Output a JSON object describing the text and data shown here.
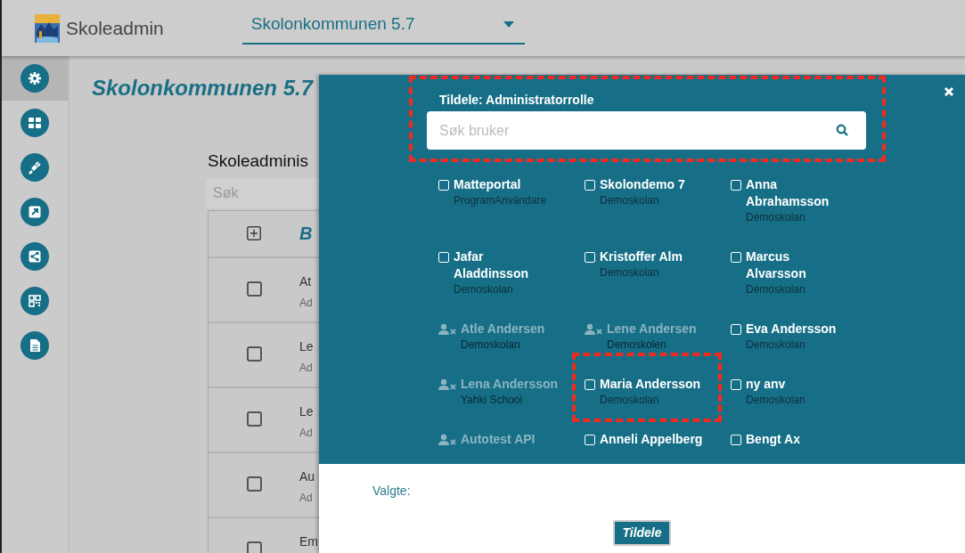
{
  "header": {
    "app_name": "Skoleadmin",
    "municipality_select": "Skolonkommunen 5.7"
  },
  "sidebar": {
    "items": [
      {
        "kind": "gear",
        "selected": true
      },
      {
        "kind": "grid",
        "selected": false
      },
      {
        "kind": "plug",
        "selected": false
      },
      {
        "kind": "external",
        "selected": false
      },
      {
        "kind": "share",
        "selected": false
      },
      {
        "kind": "qr",
        "selected": false
      },
      {
        "kind": "document",
        "selected": false
      }
    ]
  },
  "page": {
    "title": "Skolonkommunen 5.7",
    "section_title": "Skoleadminis",
    "search": {
      "placeholder": "Søk"
    },
    "table": {
      "columns": [
        "B"
      ],
      "rows": [
        {
          "name": "At",
          "sub": "Ad",
          "checked": false
        },
        {
          "name": "Le",
          "sub": "Ad",
          "checked": false
        },
        {
          "name": "Le",
          "sub": "Ad",
          "checked": false
        },
        {
          "name": "Au",
          "sub": "Ad",
          "checked": false
        },
        {
          "name": "Em",
          "checked": false
        }
      ]
    }
  },
  "dialog": {
    "title": "Tildele: Administratorrolle",
    "search": {
      "placeholder": "Søk bruker",
      "highlighted": true
    },
    "users": [
      {
        "kind": "user",
        "name": "Matteportal",
        "school": "ProgramAnvändare",
        "checked": false,
        "highlighted": false
      },
      {
        "kind": "user",
        "name": "Skolondemo 7",
        "school": "Demoskolan",
        "checked": false,
        "highlighted": false
      },
      {
        "kind": "user",
        "name": "Anna Abrahamsson",
        "school": "Demoskolan",
        "checked": false,
        "highlighted": false
      },
      {
        "kind": "user",
        "name": "Jafar Aladdinsson",
        "school": "Demoskolan",
        "checked": false,
        "highlighted": false
      },
      {
        "kind": "user",
        "name": "Kristoffer Alm",
        "school": "Demoskolan",
        "checked": false,
        "highlighted": false
      },
      {
        "kind": "user",
        "name": "Marcus Alvarsson",
        "school": "Demoskolan",
        "checked": false,
        "highlighted": false
      },
      {
        "kind": "inactive",
        "name": "Atle Andersen",
        "school": "Demoskolan",
        "highlighted": false
      },
      {
        "kind": "inactive",
        "name": "Lene Andersen",
        "school": "Demoskolen",
        "highlighted": false
      },
      {
        "kind": "user",
        "name": "Eva Andersson",
        "school": "Demoskolan",
        "checked": false,
        "highlighted": false
      },
      {
        "kind": "inactive",
        "name": "Lena Andersson",
        "school": "Yahki School",
        "highlighted": false
      },
      {
        "kind": "user",
        "name": "Maria Andersson",
        "school": "Demoskolan",
        "checked": false,
        "highlighted": true
      },
      {
        "kind": "user",
        "name": "ny anv",
        "school": "Demoskolan",
        "checked": false,
        "highlighted": false
      },
      {
        "kind": "inactive",
        "name": "Autotest API",
        "highlighted": false
      },
      {
        "kind": "user",
        "name": "Anneli Appelberg",
        "checked": false,
        "highlighted": false
      },
      {
        "kind": "user",
        "name": "Bengt Ax",
        "checked": false,
        "highlighted": false
      }
    ],
    "selected_label": "Valgte:",
    "assign_button": "Tildele"
  }
}
